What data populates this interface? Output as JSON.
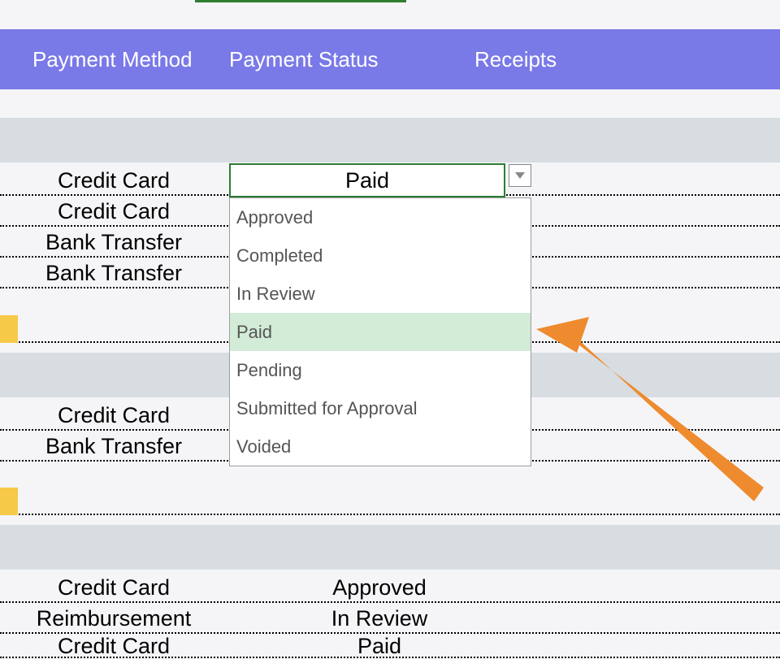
{
  "header": {
    "payment_method": "Payment Method",
    "payment_status": "Payment Status",
    "receipts": "Receipts"
  },
  "active_cell": {
    "value": "Paid"
  },
  "dropdown_options": [
    {
      "label": "Approved"
    },
    {
      "label": "Completed"
    },
    {
      "label": "In Review"
    },
    {
      "label": "Paid"
    },
    {
      "label": "Pending"
    },
    {
      "label": "Submitted for Approval"
    },
    {
      "label": "Voided"
    }
  ],
  "dropdown_highlight_index": 3,
  "rows": [
    {
      "method": "Credit Card",
      "status": ""
    },
    {
      "method": "Credit Card",
      "status": ""
    },
    {
      "method": "Bank Transfer",
      "status": ""
    },
    {
      "method": "Bank Transfer",
      "status": ""
    },
    {
      "method": "",
      "status": ""
    },
    {
      "method": "",
      "status": ""
    },
    {
      "method": "Credit Card",
      "status": ""
    },
    {
      "method": "Bank Transfer",
      "status": ""
    },
    {
      "method": "",
      "status": ""
    },
    {
      "method": "",
      "status": ""
    },
    {
      "method": "Credit Card",
      "status": "Approved"
    },
    {
      "method": "Reimbursement",
      "status": "In Review"
    },
    {
      "method": "Credit Card",
      "status": "Paid"
    }
  ],
  "colors": {
    "header_bg": "#7a79e8",
    "green": "#2e7d32",
    "dropdown_highlight": "#d2ecd7",
    "gray_band": "#d8dde2",
    "yellow_tab": "#f7c948",
    "arrow": "#ee8b2e"
  }
}
